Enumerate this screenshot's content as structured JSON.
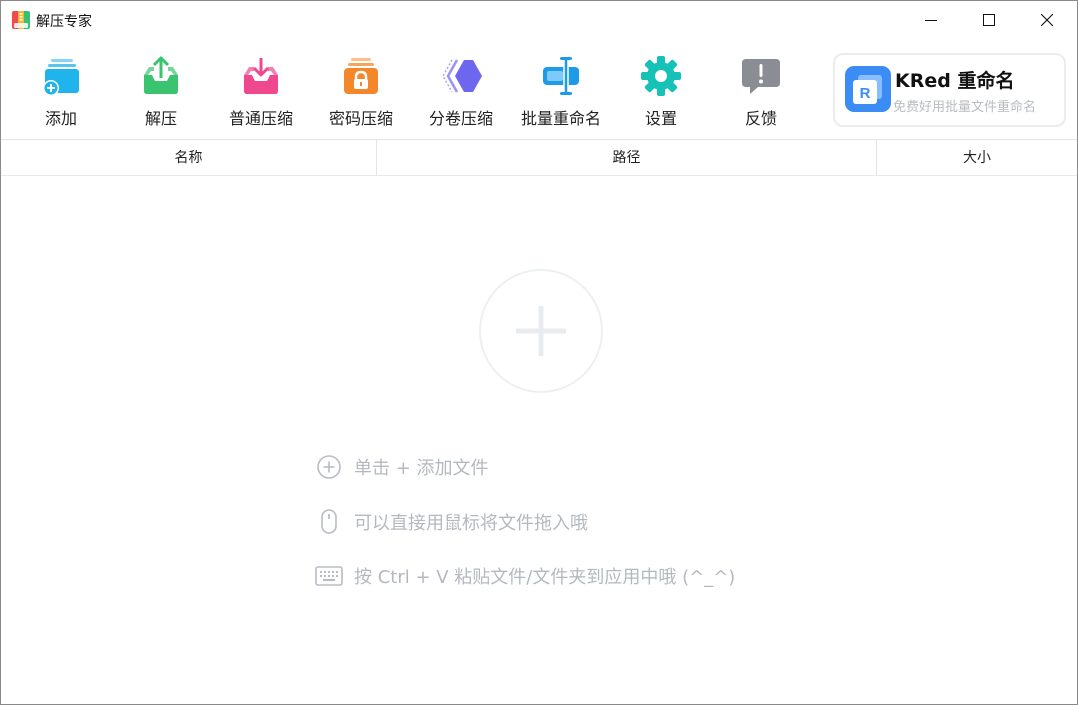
{
  "window": {
    "title": "解压专家"
  },
  "toolbar": {
    "items": [
      {
        "label": "添加",
        "icon": "add-archive-icon",
        "color": "#1fb4ec"
      },
      {
        "label": "解压",
        "icon": "extract-icon",
        "color": "#3bc46f"
      },
      {
        "label": "普通压缩",
        "icon": "compress-icon",
        "color": "#f0488e"
      },
      {
        "label": "密码压缩",
        "icon": "lock-compress-icon",
        "color": "#f5872b"
      },
      {
        "label": "分卷压缩",
        "icon": "split-volume-icon",
        "color": "#6d66ef"
      },
      {
        "label": "批量重命名",
        "icon": "batch-rename-icon",
        "color": "#1e9be8"
      },
      {
        "label": "设置",
        "icon": "gear-icon",
        "color": "#16c1b8"
      },
      {
        "label": "反馈",
        "icon": "feedback-icon",
        "color": "#8a8d93"
      }
    ]
  },
  "promo": {
    "title": "KRed 重命名",
    "subtitle": "免费好用批量文件重命名",
    "logo_color": "#3b8df5"
  },
  "table": {
    "columns": [
      "名称",
      "路径",
      "大小"
    ]
  },
  "empty_state": {
    "icon": "plus-icon",
    "hints": [
      {
        "icon": "plus-circle-icon",
        "text": "单击 + 添加文件"
      },
      {
        "icon": "mouse-icon",
        "text": "可以直接用鼠标将文件拖入哦"
      },
      {
        "icon": "keyboard-icon",
        "text": "按 Ctrl + V 粘贴文件/文件夹到应用中哦 (^_^)"
      }
    ]
  }
}
